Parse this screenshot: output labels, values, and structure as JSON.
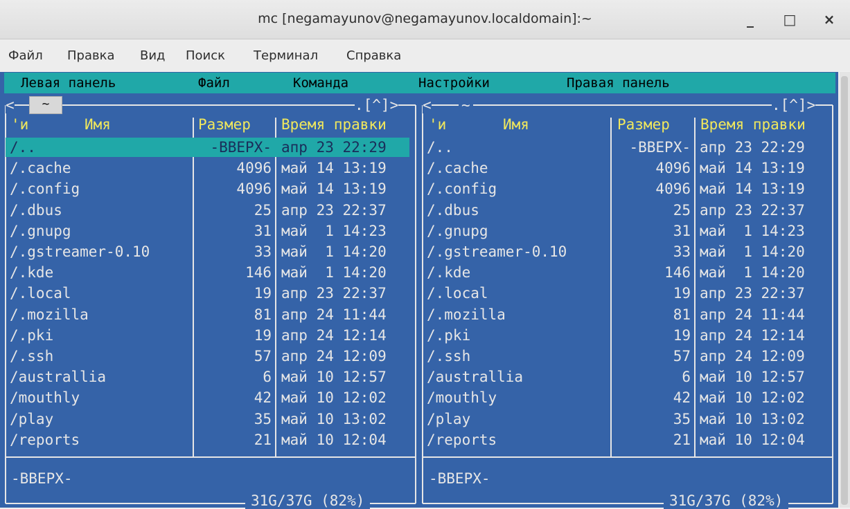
{
  "window": {
    "title": "mc [negamayunov@negamayunov.localdomain]:~",
    "min_label": "_",
    "max_label": "□",
    "close_label": "×"
  },
  "menubar": {
    "items": [
      "Файл",
      "Правка",
      "Вид",
      "Поиск",
      "Терминал",
      "Справка"
    ]
  },
  "mc_menu": {
    "items": [
      "Левая панель",
      "Файл",
      "Команда",
      "Настройки",
      "Правая панель"
    ]
  },
  "colors": {
    "panel_bg": "#3563a8",
    "cyan": "#20a8a8",
    "header_yellow": "#f1e85c",
    "text": "#e6e6e6"
  },
  "left_panel": {
    "path_label": "~",
    "corner_marker": ".[^]>",
    "left_arrow": "<",
    "columns": [
      "'и",
      "Имя",
      "Размер",
      "Время правки"
    ],
    "rows": [
      {
        "name": "/..",
        "size": "-ВВЕРХ-",
        "mtime": "апр 23 22:29"
      },
      {
        "name": "/.cache",
        "size": "4096",
        "mtime": "май 14 13:19"
      },
      {
        "name": "/.config",
        "size": "4096",
        "mtime": "май 14 13:19"
      },
      {
        "name": "/.dbus",
        "size": "25",
        "mtime": "апр 23 22:37"
      },
      {
        "name": "/.gnupg",
        "size": "31",
        "mtime": "май  1 14:23"
      },
      {
        "name": "/.gstreamer-0.10",
        "size": "33",
        "mtime": "май  1 14:20"
      },
      {
        "name": "/.kde",
        "size": "146",
        "mtime": "май  1 14:20"
      },
      {
        "name": "/.local",
        "size": "19",
        "mtime": "апр 23 22:37"
      },
      {
        "name": "/.mozilla",
        "size": "81",
        "mtime": "апр 24 11:44"
      },
      {
        "name": "/.pki",
        "size": "19",
        "mtime": "апр 24 12:14"
      },
      {
        "name": "/.ssh",
        "size": "57",
        "mtime": "апр 24 12:09"
      },
      {
        "name": "/australlia",
        "size": "6",
        "mtime": "май 10 12:57"
      },
      {
        "name": "/mouthly",
        "size": "42",
        "mtime": "май 10 12:02"
      },
      {
        "name": "/play",
        "size": "35",
        "mtime": "май 10 13:02"
      },
      {
        "name": "/reports",
        "size": "21",
        "mtime": "май 10 12:04"
      }
    ],
    "status": "-ВВЕРХ-",
    "disk": "31G/37G (82%)"
  },
  "right_panel": {
    "path_label": "~",
    "corner_marker": ".[^]>",
    "left_arrow": "<",
    "columns": [
      "'и",
      "Имя",
      "Размер",
      "Время правки"
    ],
    "rows": [
      {
        "name": "/..",
        "size": "-ВВЕРХ-",
        "mtime": "апр 23 22:29"
      },
      {
        "name": "/.cache",
        "size": "4096",
        "mtime": "май 14 13:19"
      },
      {
        "name": "/.config",
        "size": "4096",
        "mtime": "май 14 13:19"
      },
      {
        "name": "/.dbus",
        "size": "25",
        "mtime": "апр 23 22:37"
      },
      {
        "name": "/.gnupg",
        "size": "31",
        "mtime": "май  1 14:23"
      },
      {
        "name": "/.gstreamer-0.10",
        "size": "33",
        "mtime": "май  1 14:20"
      },
      {
        "name": "/.kde",
        "size": "146",
        "mtime": "май  1 14:20"
      },
      {
        "name": "/.local",
        "size": "19",
        "mtime": "апр 23 22:37"
      },
      {
        "name": "/.mozilla",
        "size": "81",
        "mtime": "апр 24 11:44"
      },
      {
        "name": "/.pki",
        "size": "19",
        "mtime": "апр 24 12:14"
      },
      {
        "name": "/.ssh",
        "size": "57",
        "mtime": "апр 24 12:09"
      },
      {
        "name": "/australlia",
        "size": "6",
        "mtime": "май 10 12:57"
      },
      {
        "name": "/mouthly",
        "size": "42",
        "mtime": "май 10 12:02"
      },
      {
        "name": "/play",
        "size": "35",
        "mtime": "май 10 13:02"
      },
      {
        "name": "/reports",
        "size": "21",
        "mtime": "май 10 12:04"
      }
    ],
    "status": "-ВВЕРХ-",
    "disk": "31G/37G (82%)"
  }
}
